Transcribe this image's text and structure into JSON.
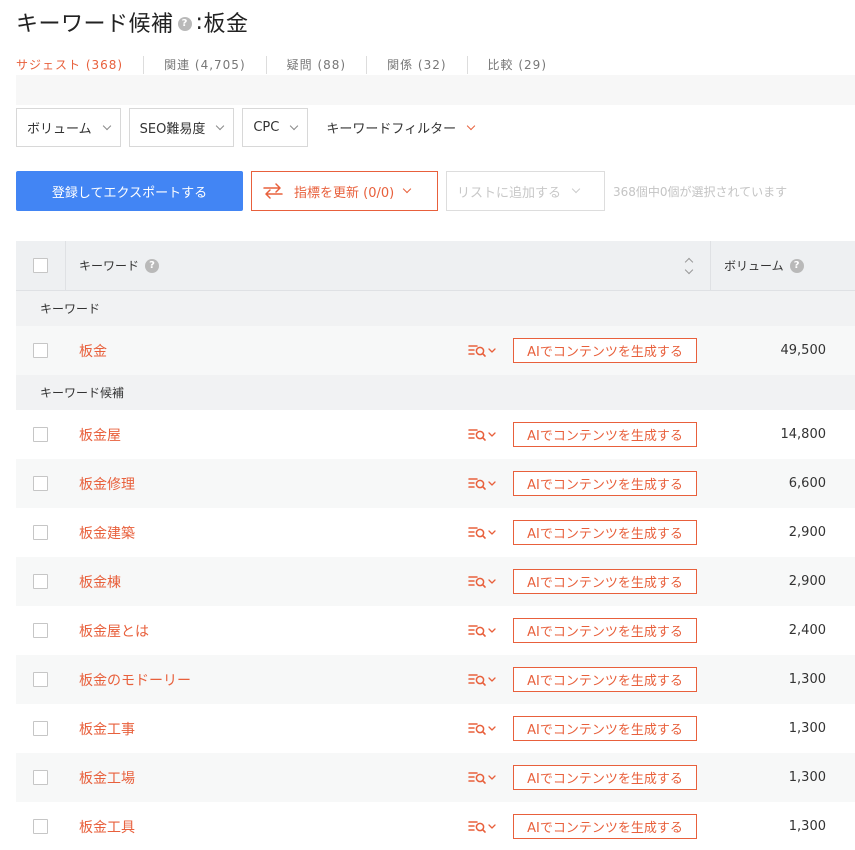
{
  "title": {
    "prefix": "キーワード候補",
    "separator": ":",
    "keyword": "板金"
  },
  "tabs": [
    {
      "label": "サジェスト (368)",
      "active": true
    },
    {
      "label": "関連 (4,705)"
    },
    {
      "label": "疑問 (88)"
    },
    {
      "label": "関係 (32)"
    },
    {
      "label": "比較 (29)"
    }
  ],
  "filters": {
    "volume": "ボリューム",
    "seo_difficulty": "SEO難易度",
    "cpc": "CPC",
    "keyword_filter": "キーワードフィルター"
  },
  "actions": {
    "export": "登録してエクスポートする",
    "update_metrics": "指標を更新 (0/0)",
    "add_to_list": "リストに追加する",
    "selected_count": "368個中0個が選択されています"
  },
  "table": {
    "headers": {
      "keyword": "キーワード",
      "volume": "ボリューム"
    },
    "groups": [
      {
        "label": "キーワード",
        "rows": [
          {
            "keyword": "板金",
            "volume": "49,500"
          }
        ]
      },
      {
        "label": "キーワード候補",
        "rows": [
          {
            "keyword": "板金屋",
            "volume": "14,800"
          },
          {
            "keyword": "板金修理",
            "volume": "6,600"
          },
          {
            "keyword": "板金建築",
            "volume": "2,900"
          },
          {
            "keyword": "板金棟",
            "volume": "2,900"
          },
          {
            "keyword": "板金屋とは",
            "volume": "2,400"
          },
          {
            "keyword": "板金のモドーリー",
            "volume": "1,300"
          },
          {
            "keyword": "板金工事",
            "volume": "1,300"
          },
          {
            "keyword": "板金工場",
            "volume": "1,300"
          },
          {
            "keyword": "板金工具",
            "volume": "1,300"
          }
        ]
      }
    ],
    "ai_button_label": "AIでコンテンツを生成する"
  },
  "icons": {
    "help": "help-icon",
    "serp": "serp-analysis-icon",
    "refresh": "refresh-arrows-icon",
    "sort": "sort-icon"
  },
  "colors": {
    "accent": "#e8603c",
    "primary": "#4285f4",
    "header_bg": "#eef0f2"
  }
}
